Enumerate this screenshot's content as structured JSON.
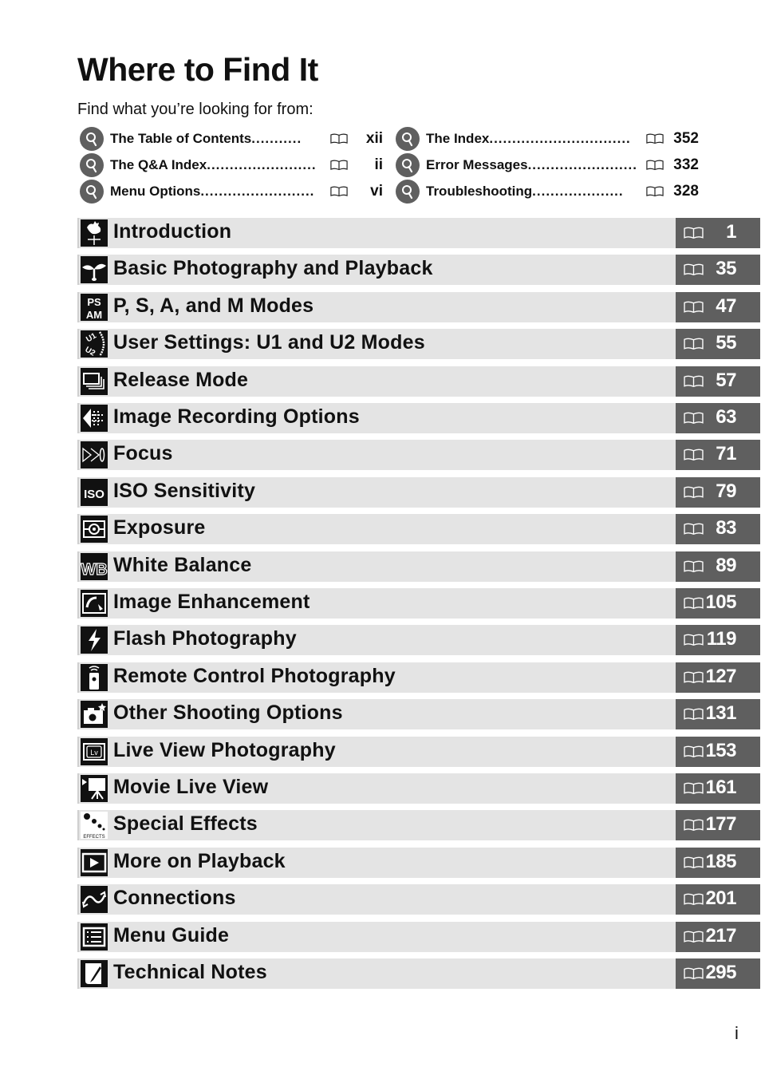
{
  "page": {
    "title": "Where to Find It",
    "subtitle": "Find what you’re looking for from:",
    "folio": "i"
  },
  "finder": {
    "left": [
      {
        "label": "The Table of Contents",
        "dots": "...........",
        "page": "xii"
      },
      {
        "label": "The Q&A Index",
        "dots": "........................",
        "page": "ii"
      },
      {
        "label": "Menu Options",
        "dots": ".........................",
        "page": "vi"
      }
    ],
    "right": [
      {
        "label": "The Index",
        "dots": "...............................",
        "page": "352"
      },
      {
        "label": "Error Messages",
        "dots": "........................",
        "page": "332"
      },
      {
        "label": "Troubleshooting",
        "dots": "....................",
        "page": "328"
      }
    ]
  },
  "chapters": [
    {
      "label": "Introduction",
      "page": "1",
      "icon": "weathervane-icon"
    },
    {
      "label": "Basic Photography and Playback",
      "page": "35",
      "icon": "sprout-icon"
    },
    {
      "label": "P, S, A, and M Modes",
      "page": "47",
      "icon": "psam-icon"
    },
    {
      "label": "User Settings: U1 and U2 Modes",
      "page": "55",
      "icon": "u1-u2-dial-icon"
    },
    {
      "label": "Release Mode",
      "page": "57",
      "icon": "release-mode-icon"
    },
    {
      "label": "Image Recording Options",
      "page": "63",
      "icon": "image-recording-icon"
    },
    {
      "label": "Focus",
      "page": "71",
      "icon": "focus-icon"
    },
    {
      "label": "ISO Sensitivity",
      "page": "79",
      "icon": "iso-icon"
    },
    {
      "label": "Exposure",
      "page": "83",
      "icon": "metering-icon"
    },
    {
      "label": "White Balance",
      "page": "89",
      "icon": "white-balance-icon"
    },
    {
      "label": "Image Enhancement",
      "page": "105",
      "icon": "image-enhancement-icon"
    },
    {
      "label": "Flash Photography",
      "page": "119",
      "icon": "flash-icon"
    },
    {
      "label": "Remote Control Photography",
      "page": "127",
      "icon": "remote-control-icon"
    },
    {
      "label": "Other Shooting Options",
      "page": "131",
      "icon": "camera-star-icon"
    },
    {
      "label": "Live View Photography",
      "page": "153",
      "icon": "live-view-icon"
    },
    {
      "label": "Movie Live View",
      "page": "161",
      "icon": "movie-camera-icon"
    },
    {
      "label": "Special Effects",
      "page": "177",
      "icon": "effects-icon"
    },
    {
      "label": "More on Playback",
      "page": "185",
      "icon": "playback-icon"
    },
    {
      "label": "Connections",
      "page": "201",
      "icon": "connections-icon"
    },
    {
      "label": "Menu Guide",
      "page": "217",
      "icon": "menu-guide-icon"
    },
    {
      "label": "Technical Notes",
      "page": "295",
      "icon": "technical-notes-icon"
    }
  ],
  "icon_text": {
    "psam_top": "PS",
    "psam_bottom": "AM",
    "iso": "ISO",
    "wb": "WB",
    "lv": "Lv",
    "effects": "EFFECTS"
  },
  "colors": {
    "bar_background": "#e4e4e4",
    "page_box": "#5f5f5f",
    "magnifier_circle": "#5f5f5f"
  }
}
